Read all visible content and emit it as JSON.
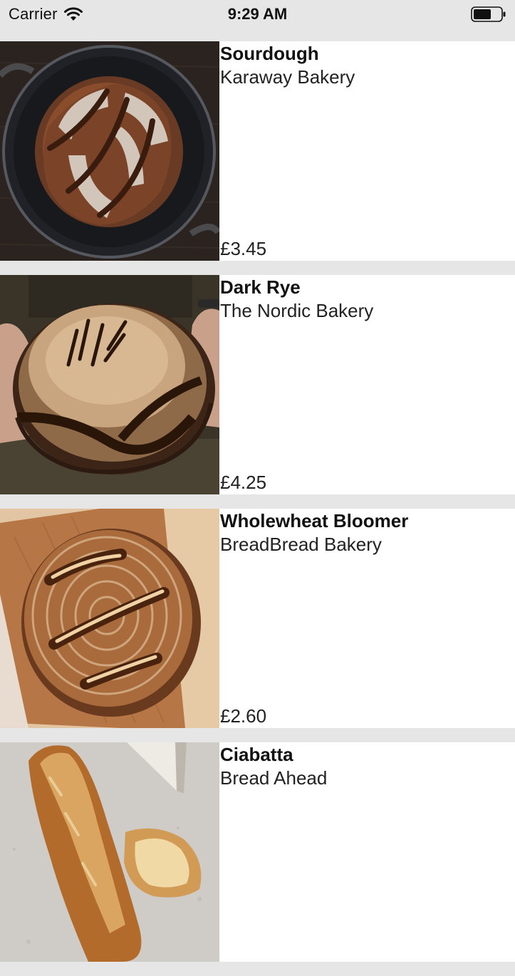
{
  "status_bar": {
    "carrier": "Carrier",
    "time": "9:29 AM",
    "wifi_icon": "wifi-icon",
    "battery_icon": "battery-icon"
  },
  "colors": {
    "background": "#e6e6e6",
    "row_background": "#ffffff",
    "text": "#111111"
  },
  "breads": [
    {
      "name": "Sourdough",
      "bakery": "Karaway Bakery",
      "price": "£3.45",
      "image": "sourdough-loaf-in-dutch-oven"
    },
    {
      "name": "Dark Rye",
      "bakery": "The Nordic Bakery",
      "price": "£4.25",
      "image": "dark-rye-loaf-held-in-hands"
    },
    {
      "name": "Wholewheat Bloomer",
      "bakery": "BreadBread Bakery",
      "price": "£2.60",
      "image": "wholewheat-loaf-on-cutting-board"
    },
    {
      "name": "Ciabatta",
      "bakery": "Bread Ahead",
      "price": "",
      "image": "ciabatta-with-cheese"
    }
  ]
}
